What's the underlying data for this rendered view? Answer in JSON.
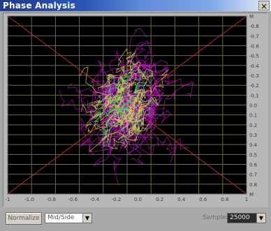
{
  "window": {
    "title": "Phase Analysis",
    "close_label": "×"
  },
  "controls": {
    "normalize_label": "Normalize",
    "mode_value": "Mid/Side",
    "samples_label": "Samples",
    "samples_value": "25000"
  },
  "icons": {
    "close": "close-icon",
    "dropdown": "chevron-down-icon"
  },
  "colors": {
    "plot_background": "#000000",
    "grid": "#6f6a4a",
    "diagonal": "#c02a2a",
    "trace_magenta": "#d11bd1",
    "trace_green": "#4ac86b",
    "trace_yellow": "#d7d35b"
  },
  "chart_data": {
    "type": "scatter",
    "title": "",
    "xlabel": "",
    "ylabel": "",
    "x_ticks": [
      "-1",
      "-1.0",
      "-0.8",
      "-0.6",
      "-0.4",
      "-0.2",
      "0.0",
      "0.2",
      "0.4",
      "0.6",
      "0.8",
      "1"
    ],
    "y_ticks": [
      "M",
      "-0.8",
      "-0.7",
      "-0.6",
      "-0.5",
      "-0.4",
      "-0.3",
      "-0.2",
      "-0.1",
      "0.0",
      "0.1",
      "0.2",
      "0.3",
      "0.4",
      "0.5",
      "0.6",
      "0.7",
      "0.8",
      "M"
    ],
    "xlim": [
      -1,
      1
    ],
    "ylim": [
      -1,
      1
    ],
    "grid": true,
    "legend": "none",
    "diagonals": true,
    "series": [
      {
        "color": "#d11bd1",
        "center": [
          0.0,
          0.02
        ],
        "spread": [
          0.32,
          0.55
        ],
        "tilt_deg": -18
      },
      {
        "color": "#4ac86b",
        "center": [
          0.0,
          0.0
        ],
        "spread": [
          0.22,
          0.35
        ],
        "tilt_deg": -18
      },
      {
        "color": "#d7d35b",
        "center": [
          0.0,
          0.0
        ],
        "spread": [
          0.26,
          0.45
        ],
        "tilt_deg": -18
      }
    ]
  }
}
